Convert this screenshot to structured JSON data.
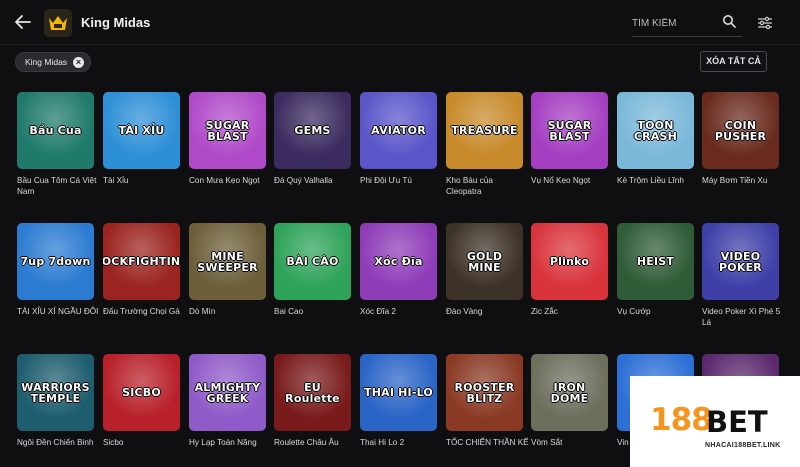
{
  "header": {
    "provider_name": "King Midas",
    "search_placeholder": "TÌM KIẾM"
  },
  "filters": {
    "active_chip": "King Midas",
    "clear_all": "XÓA TẤT CẢ"
  },
  "games": [
    {
      "label": "Bầu Cua Tôm Cá Việt Nam",
      "thumb_text": "Bầu Cua",
      "bg": "#1f7a6b"
    },
    {
      "label": "Tài Xỉu",
      "thumb_text": "TÀI XỈU",
      "bg": "#2d8fd6"
    },
    {
      "label": "Con Mưa Kẹo Ngọt",
      "thumb_text": "SUGAR BLAST",
      "bg": "#b04ac9"
    },
    {
      "label": "Đá Quý Valhalla",
      "thumb_text": "GEMS",
      "bg": "#3b2b5f"
    },
    {
      "label": "Phi Đội Ưu Tú",
      "thumb_text": "AVIATOR",
      "bg": "#5a55c9"
    },
    {
      "label": "Kho Báu của Cleopatra",
      "thumb_text": "TREASURE",
      "bg": "#c88a2a"
    },
    {
      "label": "Vụ Nổ Kẹo Ngọt",
      "thumb_text": "SUGAR BLAST",
      "bg": "#a53fc2"
    },
    {
      "label": "Kẻ Trộm Liều Lĩnh",
      "thumb_text": "TOON CRASH",
      "bg": "#7ab8d9"
    },
    {
      "label": "Máy Bơm Tiền Xu",
      "thumb_text": "COIN PUSHER",
      "bg": "#6a2b1e"
    },
    {
      "label": "TÀI XỈU XÍ NGẦU ĐÔI",
      "thumb_text": "7up 7down",
      "bg": "#2b7bd1"
    },
    {
      "label": "Đấu Trường Chọi Gà",
      "thumb_text": "COCKFIGHTING",
      "bg": "#9b2420"
    },
    {
      "label": "Dò Mìn",
      "thumb_text": "MINE SWEEPER",
      "bg": "#6d5f3a"
    },
    {
      "label": "Bai Cao",
      "thumb_text": "BÀI CÀO",
      "bg": "#2fa35a"
    },
    {
      "label": "Xóc Đĩa 2",
      "thumb_text": "Xóc Đĩa",
      "bg": "#8e3cb8"
    },
    {
      "label": "Đào Vàng",
      "thumb_text": "GOLD MINE",
      "bg": "#3d3227"
    },
    {
      "label": "Zic Zắc",
      "thumb_text": "Plinko",
      "bg": "#d9343c"
    },
    {
      "label": "Vụ Cướp",
      "thumb_text": "HEIST",
      "bg": "#2f5b36"
    },
    {
      "label": "Video Poker Xì Phé 5 Lá",
      "thumb_text": "VIDEO POKER",
      "bg": "#3e40a8"
    },
    {
      "label": "Ngôi Đền Chiến Binh",
      "thumb_text": "WARRIORS TEMPLE",
      "bg": "#1d5d6e"
    },
    {
      "label": "Sicbo",
      "thumb_text": "SICBO",
      "bg": "#b8202a"
    },
    {
      "label": "Hy Lạp Toàn Năng",
      "thumb_text": "ALMIGHTY GREEK",
      "bg": "#8f5bc8"
    },
    {
      "label": "Roulette Châu Âu",
      "thumb_text": "EU Roulette",
      "bg": "#7a1b1b"
    },
    {
      "label": "Thai Hi Lo 2",
      "thumb_text": "THAI HI-LO",
      "bg": "#2a64c7"
    },
    {
      "label": "TỐC CHIẾN THẦN KẾ",
      "thumb_text": "ROOSTER BLITZ",
      "bg": "#8a3a24"
    },
    {
      "label": "Vòm Sắt",
      "thumb_text": "IRON DOME",
      "bg": "#6d6e5c"
    },
    {
      "label": "Vin",
      "thumb_text": "",
      "bg": "#2c6fd6"
    },
    {
      "label": "",
      "thumb_text": "",
      "bg": "#5b2a6e"
    }
  ],
  "overlay": {
    "num": "188",
    "bet": "BET",
    "site": "NHACAI188BET.LINK"
  },
  "colors": {
    "background": "#0f0f11",
    "accent_orange": "#f7941d",
    "brand_gold": "#f2b705"
  }
}
